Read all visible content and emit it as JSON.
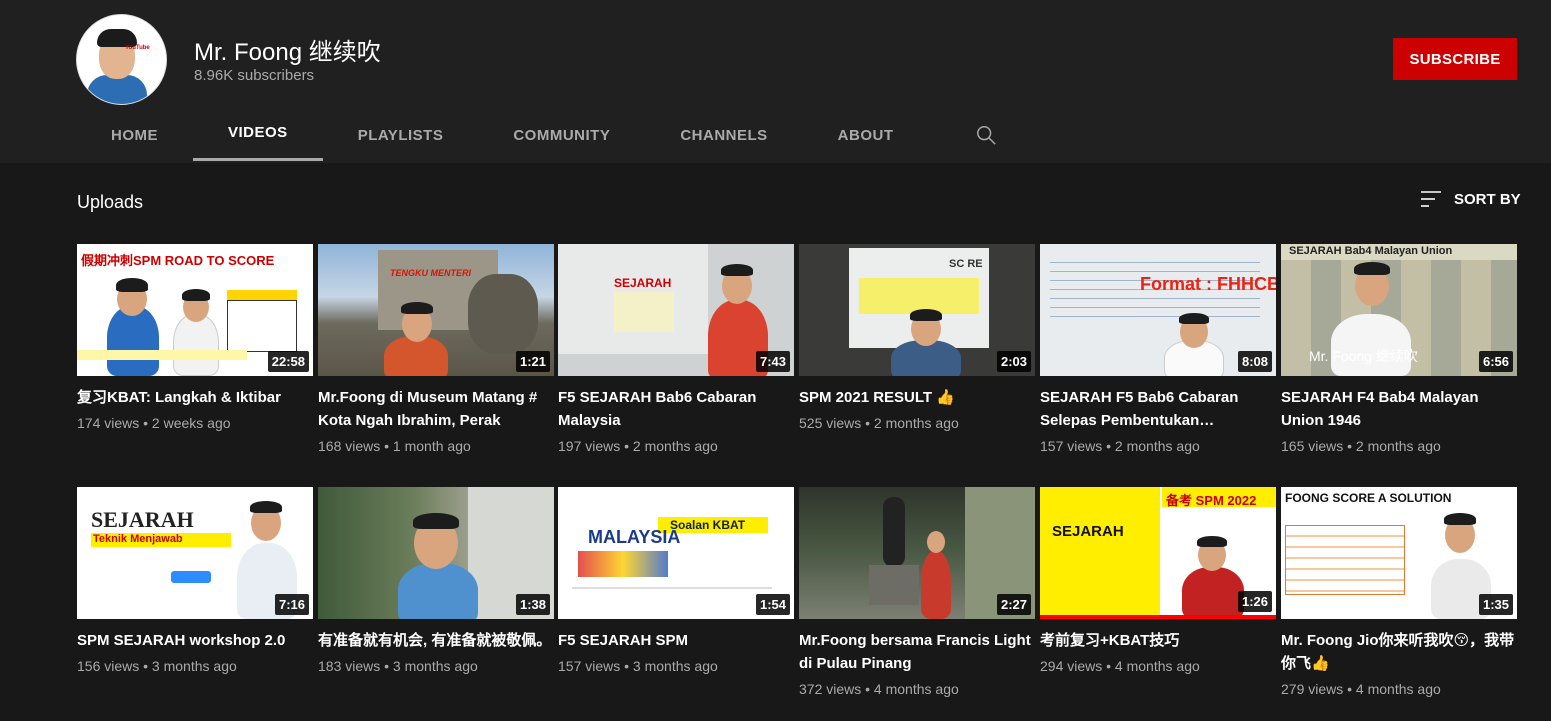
{
  "channel": {
    "name": "Mr. Foong 继续吹",
    "subscribers": "8.96K subscribers",
    "subscribe_label": "SUBSCRIBE",
    "avatar_text": "YouTube"
  },
  "tabs": [
    {
      "label": "HOME"
    },
    {
      "label": "VIDEOS"
    },
    {
      "label": "PLAYLISTS"
    },
    {
      "label": "COMMUNITY"
    },
    {
      "label": "CHANNELS"
    },
    {
      "label": "ABOUT"
    }
  ],
  "section": {
    "title": "Uploads",
    "sort_label": "SORT BY"
  },
  "colors": {
    "subscribe": "#cc0000",
    "background": "#181818",
    "header": "#202020"
  },
  "videos": [
    {
      "title": "复习KBAT: Langkah & Iktibar",
      "meta": "174 views • 2 weeks ago",
      "duration": "22:58",
      "thumb_text": "假期冲刺SPM ROAD TO SCORE"
    },
    {
      "title": "Mr.Foong di Museum Matang # Kota Ngah Ibrahim, Perak",
      "meta": "168 views • 1 month ago",
      "duration": "1:21",
      "thumb_text": "TENGKU MENTERI"
    },
    {
      "title": "F5 SEJARAH Bab6 Cabaran Malaysia",
      "meta": "197 views • 2 months ago",
      "duration": "7:43",
      "thumb_text": "SEJARAH"
    },
    {
      "title": "SPM 2021 RESULT 👍",
      "meta": "525 views • 2 months ago",
      "duration": "2:03",
      "thumb_text": "SC RE"
    },
    {
      "title": "SEJARAH F5 Bab6 Cabaran Selepas Pembentukan…",
      "meta": "157 views • 2 months ago",
      "duration": "8:08",
      "thumb_text": "Format : FHHCBI"
    },
    {
      "title": "SEJARAH F4 Bab4 Malayan Union 1946",
      "meta": "165 views • 2 months ago",
      "duration": "6:56",
      "thumb_text": "SEJARAH Bab4 Malayan Union",
      "thumb_text2": "Mr. Foong 继续吹"
    },
    {
      "title": "SPM SEJARAH workshop 2.0",
      "meta": "156 views • 3 months ago",
      "duration": "7:16",
      "thumb_text": "SEJARAH",
      "thumb_text2": "Teknik Menjawab"
    },
    {
      "title": "有准备就有机会, 有准备就被敬佩。",
      "meta": "183 views • 3 months ago",
      "duration": "1:38"
    },
    {
      "title": "F5 SEJARAH SPM",
      "meta": "157 views • 3 months ago",
      "duration": "1:54",
      "thumb_text": "Soalan KBAT",
      "thumb_text2": "MALAYSIA"
    },
    {
      "title": "Mr.Foong bersama Francis Light di Pulau Pinang",
      "meta": "372 views • 4 months ago",
      "duration": "2:27"
    },
    {
      "title": "考前复习+KBAT技巧",
      "meta": "294 views • 4 months ago",
      "duration": "1:26",
      "thumb_text": "备考 SPM 2022",
      "thumb_text2": "SEJARAH"
    },
    {
      "title": "Mr. Foong Jio你来听我吹😚，我带你飞👍",
      "meta": "279 views • 4 months ago",
      "duration": "1:35",
      "thumb_text": "FOONG SCORE A SOLUTION"
    }
  ]
}
